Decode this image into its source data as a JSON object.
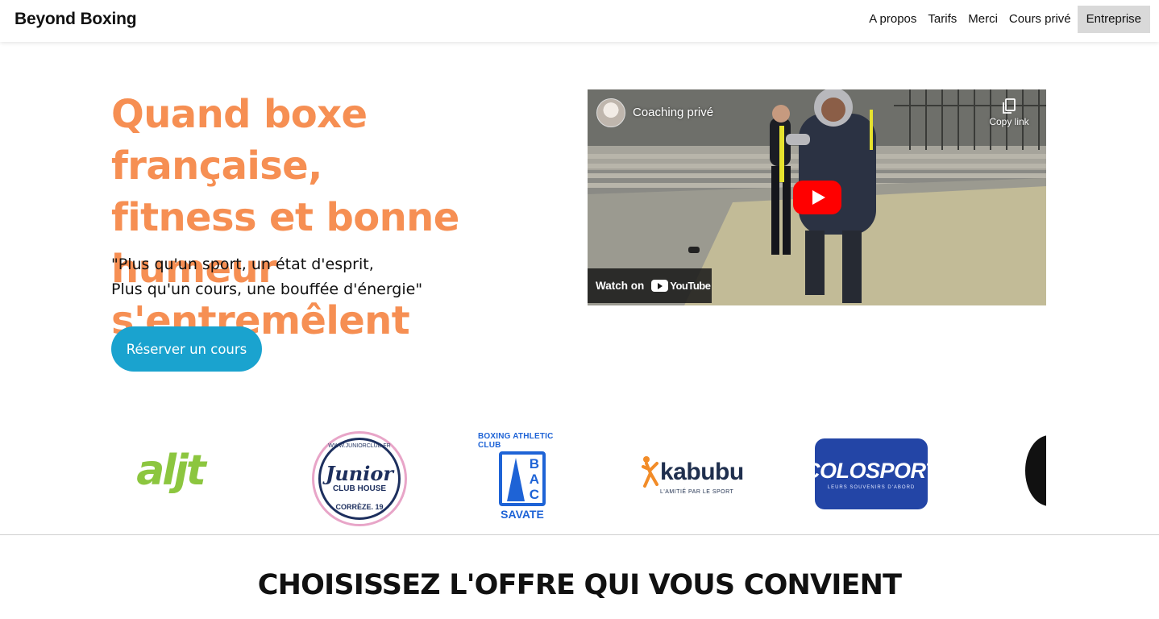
{
  "header": {
    "brand": "Beyond Boxing",
    "nav": [
      {
        "label": "A propos"
      },
      {
        "label": "Tarifs"
      },
      {
        "label": "Merci"
      },
      {
        "label": "Cours privé"
      },
      {
        "label": "Entreprise",
        "active": true
      }
    ]
  },
  "hero": {
    "title_lines": [
      "Quand boxe française,",
      "fitness et bonne",
      "humeur s'entremêlent"
    ],
    "quote_lines": [
      "\"Plus qu'un sport, un état d'esprit,",
      "Plus qu'un cours, une bouffée d'énergie\""
    ],
    "cta_label": "Réserver un cours"
  },
  "video": {
    "title": "Coaching privé",
    "copy_link_label": "Copy link",
    "watch_on_label": "Watch on",
    "youtube_label": "YouTube"
  },
  "partners": {
    "logos": [
      {
        "name": "aljt",
        "text": "aljt"
      },
      {
        "name": "junior-club-house",
        "url": "WWW.JUNIORCLUB.FR",
        "text": "Junior",
        "subtitle": "CLUB HOUSE",
        "region": "CORRÈZE. 19"
      },
      {
        "name": "boxing-athletic-club",
        "arc": "BOXING ATHLETIC CLUB",
        "letters": [
          "B",
          "A",
          "C"
        ],
        "text": "SAVATE"
      },
      {
        "name": "kabubu",
        "text": "kabubu",
        "tagline": "L'AMITIÉ PAR LE SPORT"
      },
      {
        "name": "colosport",
        "text": "COLOSPORT",
        "tagline": "LEURS SOUVENIRS D'ABORD"
      }
    ]
  },
  "offers": {
    "title": "CHOISISSEZ L'OFFRE QUI VOUS CONVIENT"
  },
  "colors": {
    "accent_orange": "#f68f53",
    "button_blue": "#1aa3cf",
    "youtube_red": "#ff0000"
  }
}
